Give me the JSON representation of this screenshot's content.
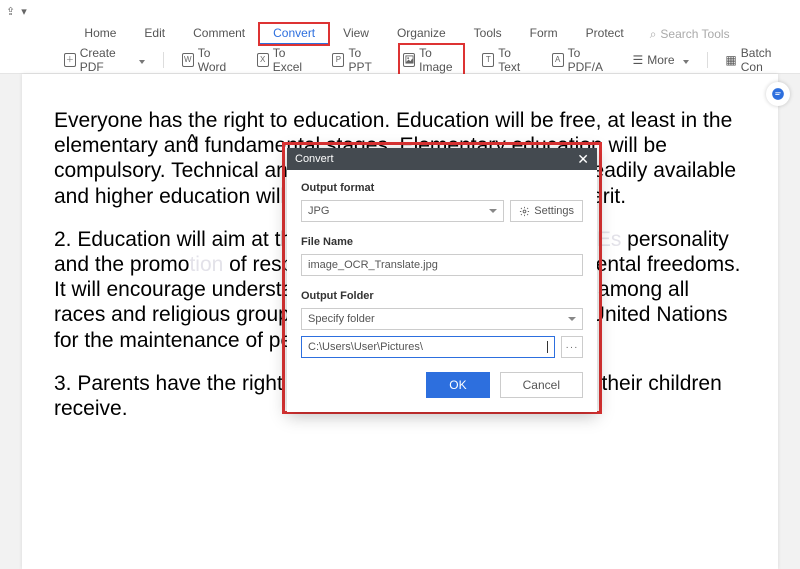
{
  "menu": {
    "items": [
      "Home",
      "Edit",
      "Comment",
      "Convert",
      "View",
      "Organize",
      "Tools",
      "Form",
      "Protect"
    ],
    "active_index": 3,
    "search_placeholder": "Search Tools"
  },
  "toolbar": {
    "create_pdf": "Create PDF",
    "to_word": "To Word",
    "to_excel": "To Excel",
    "to_ppt": "To PPT",
    "to_image": "To Image",
    "to_text": "To Text",
    "to_pdfa": "To PDF/A",
    "more": "More",
    "batch": "Batch Con",
    "icon_letters": {
      "word": "W",
      "excel": "X",
      "ppt": "P",
      "image": "",
      "text": "T",
      "pdfa": "A"
    }
  },
  "document": {
    "p1": "Everyone has the right to education. Education will be free, at least in the elementary and fundamental stages. Elementary education will be compulsory. Technical and professional education will be readily available and higher education will be equally available based on merit.",
    "p2": "2. Education will aim at the full development of the human personality and the promotion of respect for human rights and fundamental freedoms. It will encourage understanding, tolerance, and friendship among all races and religious groups; as well as the activities of the United Nations for the maintenance of peace.",
    "p3": "3. Parents have the right to choose what type of education their children receive."
  },
  "dialog": {
    "title": "Convert",
    "output_format_label": "Output format",
    "output_format_value": "JPG",
    "settings_label": "Settings",
    "filename_label": "File Name",
    "filename_value": "image_OCR_Translate.jpg",
    "folder_label": "Output Folder",
    "folder_select": "Specify folder",
    "folder_path": "C:\\Users\\User\\Pictures\\",
    "ok": "OK",
    "cancel": "Cancel",
    "ellipsis": "···"
  }
}
